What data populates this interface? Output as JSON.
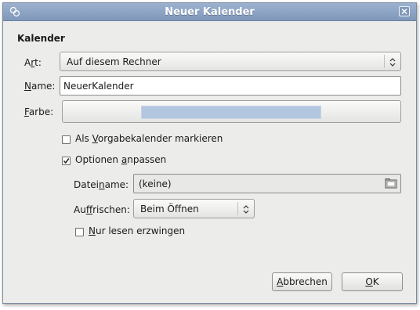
{
  "window": {
    "title": "Neuer Kalender"
  },
  "section": {
    "title": "Kalender"
  },
  "art": {
    "label_pre": "A",
    "label_ul": "r",
    "label_post": "t:",
    "value": "Auf diesem Rechner"
  },
  "name": {
    "label_pre": "",
    "label_ul": "N",
    "label_post": "ame:",
    "value": "NeuerKalender"
  },
  "farbe": {
    "label_pre": "",
    "label_ul": "F",
    "label_post": "arbe:",
    "swatch_color": "#b3c6e0"
  },
  "default_cal": {
    "label_pre": "Als ",
    "label_ul": "V",
    "label_post": "orgabekalender markieren",
    "checked": false
  },
  "custom_opts": {
    "label_pre": "Optionen ",
    "label_ul": "a",
    "label_post": "npassen",
    "checked": true
  },
  "dateiname": {
    "label_pre": "Datei",
    "label_ul": "n",
    "label_post": "ame:",
    "value": "(keine)"
  },
  "refresh": {
    "label_pre": "Au",
    "label_ul": "f",
    "label_post": "frischen:",
    "value": "Beim Öffnen"
  },
  "readonly": {
    "label_pre": "",
    "label_ul": "N",
    "label_post": "ur lesen erzwingen",
    "checked": false
  },
  "buttons": {
    "cancel": {
      "pre": "",
      "ul": "A",
      "post": "bbrechen"
    },
    "ok": {
      "pre": "",
      "ul": "O",
      "post": "K"
    }
  },
  "colors": {
    "titlebar": "#8aa2c4",
    "dialog_bg": "#ececeb"
  },
  "icons": {
    "app": "calendar-app-icon",
    "close": "close-icon",
    "combo": "updown-arrow-icon",
    "file": "folder-icon"
  }
}
